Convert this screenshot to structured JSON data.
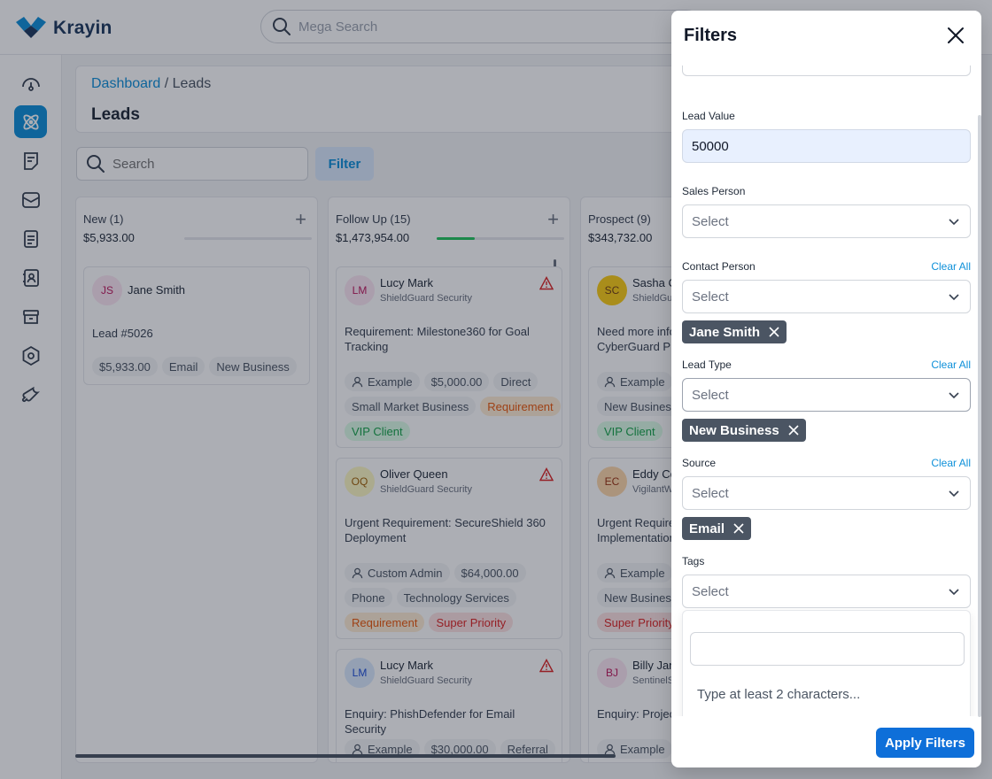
{
  "app": {
    "name": "Krayin"
  },
  "search": {
    "mega_placeholder": "Mega Search",
    "leads_placeholder": "Search"
  },
  "breadcrumb": {
    "dashboard": "Dashboard",
    "separator": "/",
    "current": "Leads"
  },
  "page": {
    "title": "Leads",
    "filter_label": "Filter"
  },
  "columns": [
    {
      "title": "New (1)",
      "amount": "$5,933.00",
      "progress": 0,
      "cards": [
        {
          "initials": "JS",
          "name": "Jane Smith",
          "org": "",
          "title": "Lead #5026",
          "tags": [
            "$5,933.00",
            "Email",
            "New Business"
          ]
        }
      ]
    },
    {
      "title": "Follow Up (15)",
      "amount": "$1,473,954.00",
      "progress": 0.3,
      "cards": [
        {
          "initials": "LM",
          "name": "Lucy Mark",
          "org": "ShieldGuard Security",
          "title": "Requirement: Milestone360 for Goal Tracking",
          "tags": [
            "Example",
            "$5,000.00",
            "Direct",
            "Small Market Business",
            "Requirement",
            "VIP Client"
          ]
        },
        {
          "initials": "OQ",
          "name": "Oliver Queen",
          "org": "ShieldGuard Security",
          "title": "Urgent Requirement: SecureShield 360 Deployment",
          "tags": [
            "Custom Admin",
            "$64,000.00",
            "Phone",
            "Technology Services",
            "Requirement",
            "Super Priority"
          ]
        },
        {
          "initials": "LM",
          "name": "Lucy Mark",
          "org": "ShieldGuard Security",
          "title": "Enquiry: PhishDefender for Email Security",
          "tags": [
            "Example",
            "$30,000.00",
            "Referral"
          ]
        }
      ]
    },
    {
      "title": "Prospect (9)",
      "amount": "$343,732.00",
      "cards": [
        {
          "initials": "SC",
          "name": "Sasha C",
          "org": "ShieldGu",
          "title_lines": [
            "Need more info",
            "CyberGuard Pr"
          ],
          "tags": [
            "Example",
            "New Business",
            "VIP Client"
          ]
        },
        {
          "initials": "EC",
          "name": "Eddy Co",
          "org": "VigilantW",
          "title_lines": [
            "Urgent Require",
            "Implementation"
          ],
          "tags": [
            "Example",
            "New Business",
            "Super Priority"
          ]
        },
        {
          "initials": "BJ",
          "name": "Billy Jan",
          "org": "SentinelS",
          "title_lines": [
            "Enquiry: Projec"
          ],
          "tags": [
            "Example"
          ]
        }
      ]
    }
  ],
  "filters": {
    "title": "Filters",
    "lead_value": {
      "label": "Lead Value",
      "value": "50000"
    },
    "sales_person": {
      "label": "Sales Person",
      "placeholder": "Select"
    },
    "contact_person": {
      "label": "Contact Person",
      "placeholder": "Select",
      "clear": "Clear All",
      "chip": "Jane Smith"
    },
    "lead_type": {
      "label": "Lead Type",
      "placeholder": "Select",
      "clear": "Clear All",
      "chip": "New Business"
    },
    "source": {
      "label": "Source",
      "placeholder": "Select",
      "clear": "Clear All",
      "chip": "Email"
    },
    "tags": {
      "label": "Tags",
      "placeholder": "Select",
      "search_value": "",
      "hint": "Type at least 2 characters..."
    },
    "apply_label": "Apply Filters"
  },
  "colors": {
    "accent": "#0e90d9",
    "apply": "#0e6fd9",
    "chip": "#4b5563"
  }
}
